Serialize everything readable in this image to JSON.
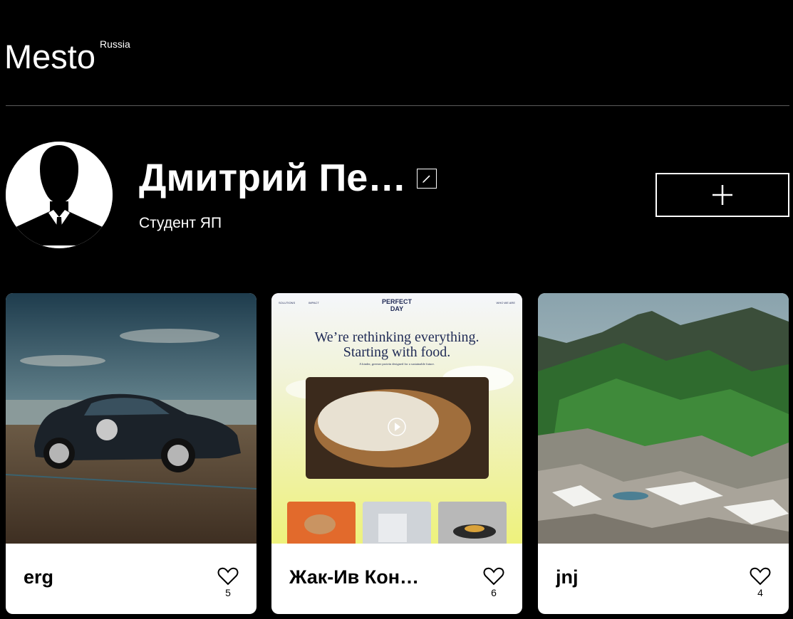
{
  "header": {
    "logo": "Mesto",
    "logo_sup": "Russia"
  },
  "profile": {
    "name": "Дмитрий Пе…",
    "about": "Студент ЯП",
    "avatar_icon": "user-silhouette-icon",
    "edit_icon": "pencil-icon",
    "add_icon": "plus-icon"
  },
  "cards": [
    {
      "title": "erg",
      "likes": "5",
      "image": "sports-car-on-beach"
    },
    {
      "title": "Жак-Ив Кон…",
      "likes": "6",
      "image": "perfect-day-website-screenshot"
    },
    {
      "title": "jnj",
      "likes": "4",
      "image": "green-mountain-landscape"
    }
  ],
  "website": {
    "nav_left_1": "SOLUTIONS",
    "nav_left_2": "IMPACT",
    "brand_line1": "PERFECT",
    "brand_line2": "DAY",
    "nav_right": "WHO WE ARE",
    "headline_1": "We’re rethinking everything.",
    "headline_2": "Starting with food.",
    "tagline": "A kinder, greener protein designed for a sustainable future."
  },
  "colors": {
    "background": "#000000",
    "text": "#ffffff",
    "card": "#ffffff",
    "divider": "#5b5b5b"
  }
}
